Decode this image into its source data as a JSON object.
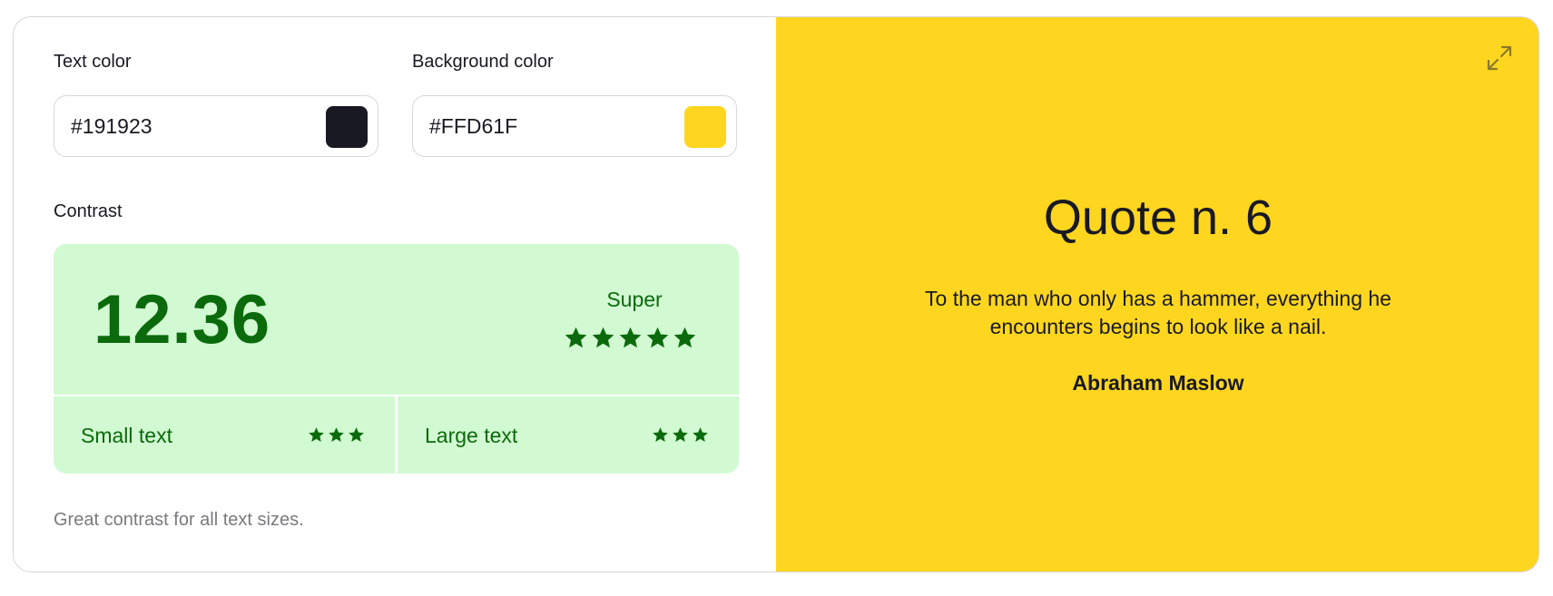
{
  "colors": {
    "text": "#191923",
    "background": "#FFD61F",
    "contrast_bg": "#D2FAD2",
    "contrast_fg": "#0B6A0B",
    "divider": "#ffffff",
    "note": "#7a7a80"
  },
  "inputs": {
    "text_color": {
      "label": "Text color",
      "value": "#191923"
    },
    "background_color": {
      "label": "Background color",
      "value": "#FFD61F"
    }
  },
  "contrast": {
    "label": "Contrast",
    "ratio": "12.36",
    "rating": "Super",
    "rating_stars": 5,
    "small_text": {
      "label": "Small text",
      "stars": 3
    },
    "large_text": {
      "label": "Large text",
      "stars": 3
    },
    "note": "Great contrast for all text sizes."
  },
  "preview": {
    "title": "Quote n. 6",
    "quote": "To the man who only has a hammer, everything he encounters begins to look like a nail.",
    "author": "Abraham Maslow",
    "expand_icon": "expand-icon"
  }
}
